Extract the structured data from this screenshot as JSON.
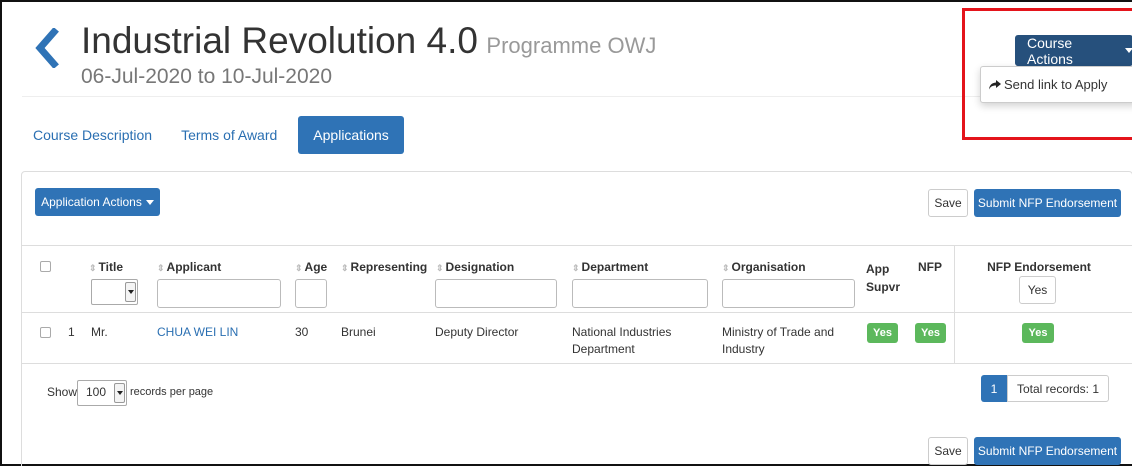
{
  "header": {
    "title": "Industrial Revolution 4.0",
    "subtitle": "Programme OWJ",
    "date_range": "06-Jul-2020 to 10-Jul-2020"
  },
  "course_actions": {
    "label": "Course Actions",
    "menu_items": [
      "Send link to Apply"
    ]
  },
  "tabs": [
    {
      "label": "Course Description",
      "active": false
    },
    {
      "label": "Terms of Award",
      "active": false
    },
    {
      "label": "Applications",
      "active": true
    }
  ],
  "panel": {
    "application_actions_label": "Application Actions",
    "save_label": "Save",
    "submit_label": "Submit NFP Endorsement",
    "columns": {
      "title": "Title",
      "applicant": "Applicant",
      "age": "Age",
      "representing": "Representing",
      "designation": "Designation",
      "department": "Department",
      "organisation": "Organisation",
      "app_supvr": "App Supvr",
      "nfp": "NFP",
      "nfp_endorsement": "NFP Endorsement"
    },
    "nfp_endorsement_filter_label": "Yes",
    "rows": [
      {
        "index": "1",
        "title": "Mr.",
        "applicant": "CHUA WEI LIN",
        "age": "30",
        "representing": "Brunei",
        "designation": "Deputy Director",
        "department": "National Industries Department",
        "organisation": "Ministry of Trade and Industry",
        "app_supvr": "Yes",
        "nfp": "Yes",
        "nfp_endorsement": "Yes"
      }
    ],
    "pagination": {
      "show_label": "Show",
      "page_size": "100",
      "per_page_label": "records per page",
      "current_page": "1",
      "total_records": "Total records: 1"
    }
  },
  "colors": {
    "primary": "#2f73b6",
    "dark_primary": "#26507c",
    "success": "#5cb85c",
    "highlight_border": "#e4141b"
  }
}
